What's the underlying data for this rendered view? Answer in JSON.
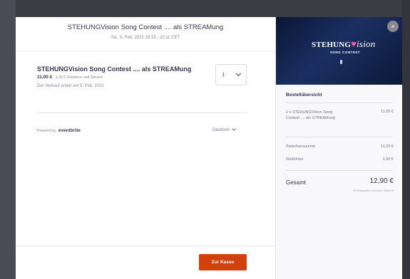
{
  "event": {
    "title": "STEHUNGVision Song Contest .... als STREAMung",
    "date": "Sa., 5. Feb. 2022 18:33 - 23:11 CET"
  },
  "ticket": {
    "name": "STEHUNGVision Song Contest .... als STREAMung",
    "price": "11,00 €",
    "fees": "1,90 € Gebühren und Steuern",
    "sale_end": "Der Verkauf endet am 5. Feb. 2022",
    "quantity": "1"
  },
  "footer": {
    "powered_by": "Powered by",
    "brand": "eventbrite",
    "language": "Deutsch",
    "checkout_label": "Zur Kasse"
  },
  "sidebar": {
    "close_symbol": "×",
    "logo": {
      "main": "STEHUNG",
      "heart": "♥",
      "rest": "ision",
      "sub": "SONG CONTEST"
    },
    "summary_title": "Bestellübersicht",
    "item": {
      "description": "1 x STEHUNGVision Song Contest .... als STREAMung",
      "amount": "11,00 €"
    },
    "subtotal": {
      "label": "Zwischensumme",
      "amount": "11,00 €"
    },
    "fees": {
      "label": "Gebühren",
      "amount": "1,90 €"
    },
    "total": {
      "label": "Gesamt",
      "amount": "12,90 €",
      "note": "Preisangaben inklusive Steuern"
    }
  },
  "colors": {
    "accent": "#d1410c",
    "hero_bg": "#0b1938",
    "text": "#39364f"
  }
}
